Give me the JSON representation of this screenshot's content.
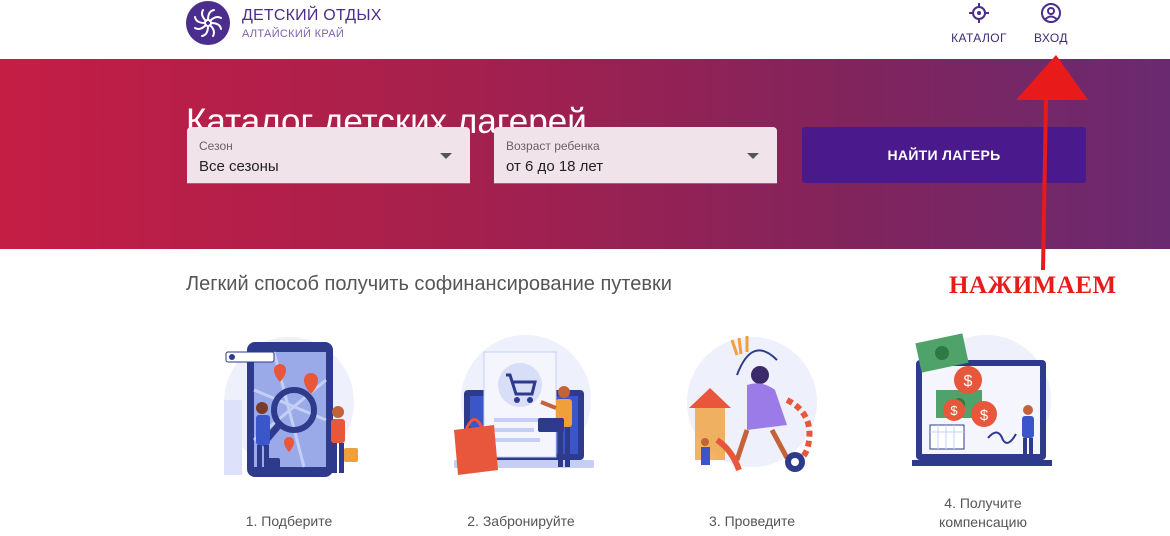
{
  "header": {
    "brand_title": "ДЕТСКИЙ ОТДЫХ",
    "brand_subtitle": "АЛТАЙСКИЙ КРАЙ",
    "logo_icon": "flower-spiral-logo",
    "nav": [
      {
        "label": "КАТАЛОГ",
        "icon": "map-pin-compass-icon"
      },
      {
        "label": "ВХОД",
        "icon": "user-circle-icon"
      }
    ]
  },
  "hero": {
    "title": "Каталог детских лагерей",
    "season": {
      "label": "Сезон",
      "value": "Все сезоны"
    },
    "age": {
      "label": "Возраст ребенка",
      "value": "от 6 до 18 лет"
    },
    "find_button": "НАЙТИ ЛАГЕРЬ"
  },
  "annotation": {
    "text": "НАЖИМАЕМ",
    "color": "#e81a1a"
  },
  "steps": {
    "title": "Легкий способ получить софинансирование путевки",
    "items": [
      {
        "label": "1. Подберите",
        "illustration": "search-map-illustration"
      },
      {
        "label": "2. Забронируйте",
        "illustration": "shopping-cart-laptop-illustration"
      },
      {
        "label": "3. Проведите",
        "illustration": "kids-playing-illustration"
      },
      {
        "label_line1": "4. Получите",
        "label_line2": "компенсацию",
        "illustration": "money-compensation-illustration"
      }
    ]
  },
  "colors": {
    "brand": "#4a2d8c",
    "hero_gradient_start": "#c41e45",
    "hero_gradient_end": "#6a2a70",
    "button": "#4a1a8c"
  }
}
